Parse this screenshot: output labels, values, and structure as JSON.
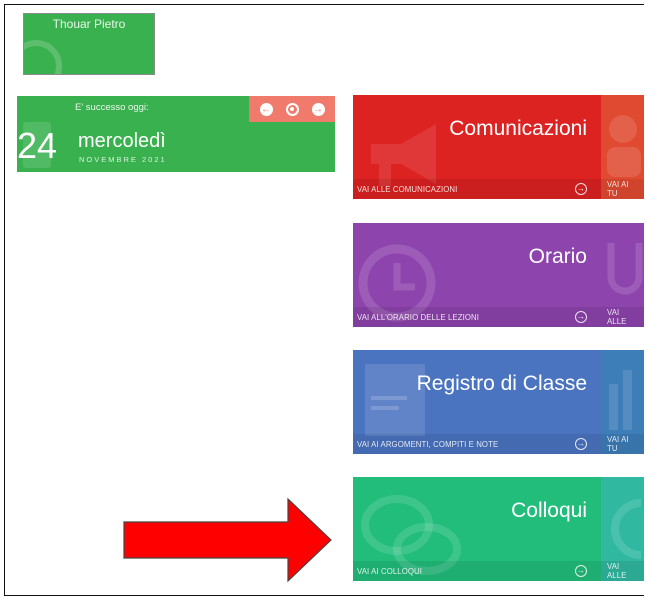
{
  "user": {
    "name": "Thouar Pietro"
  },
  "today": {
    "heading": "E' successo oggi:",
    "day": "24",
    "weekday": "mercoledì",
    "month_year": "NOVEMBRE 2021"
  },
  "tiles": [
    {
      "title": "Comunicazioni",
      "link": "VAI ALLE COMUNICAZIONI"
    },
    {
      "title": "Orario",
      "link": "VAI ALL'ORARIO DELLE LEZIONI"
    },
    {
      "title": "Registro di Classe",
      "link": "VAI AI ARGOMENTI, COMPITI E NOTE"
    },
    {
      "title": "Colloqui",
      "link": "VAI AI COLLOQUI"
    }
  ],
  "partial_tiles": [
    {
      "link": "VAI AI TU"
    },
    {
      "link": "VAI ALLE"
    },
    {
      "link": "VAI AI TU"
    },
    {
      "link": "VAI ALLE"
    }
  ],
  "colors": {
    "green": "#3ab14f",
    "red": "#dd2222",
    "purple": "#8e44ad",
    "blue": "#4a74c0",
    "teal_green": "#22bd7b",
    "arrow": "#ff0000"
  },
  "icons": {
    "prev": "arrow-left-circle-icon",
    "today": "target-icon",
    "next": "arrow-right-circle-icon",
    "tile_go": "arrow-right-circle-icon"
  }
}
